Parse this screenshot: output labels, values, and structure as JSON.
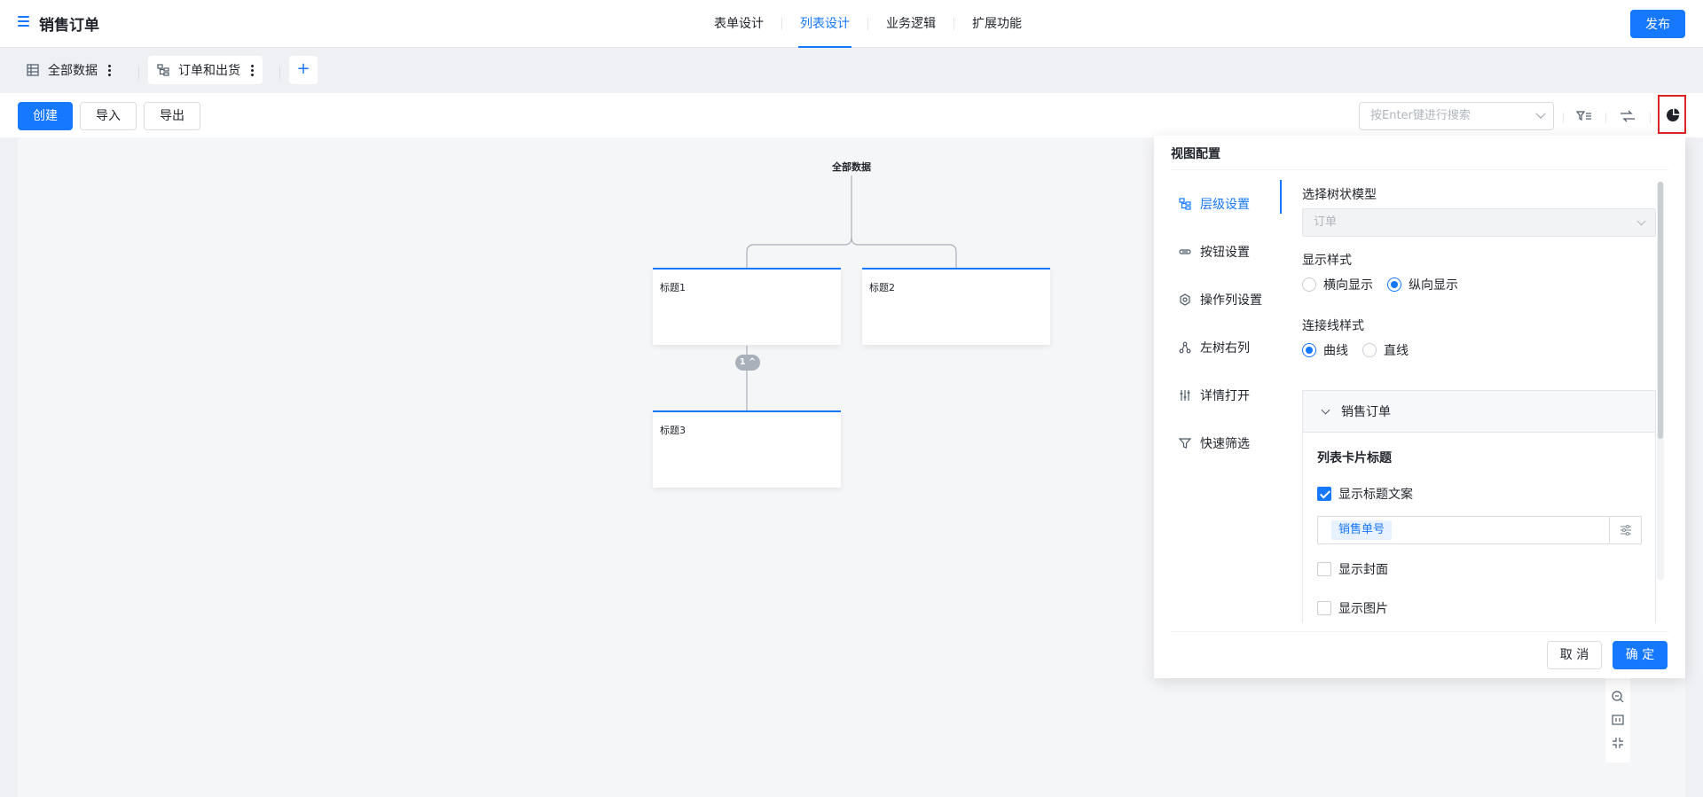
{
  "header": {
    "title": "销售订单",
    "tabs": [
      "表单设计",
      "列表设计",
      "业务逻辑",
      "扩展功能"
    ],
    "active_tab": "列表设计",
    "publish_label": "发布"
  },
  "views": {
    "items": [
      {
        "label": "全部数据",
        "icon": "grid-icon"
      },
      {
        "label": "订单和出货",
        "icon": "tree-icon"
      }
    ],
    "add_label": "+"
  },
  "toolbar": {
    "create_label": "创建",
    "import_label": "导入",
    "export_label": "导出",
    "search_placeholder": "按Enter键进行搜索"
  },
  "tree": {
    "root_label": "全部数据",
    "nodes": [
      {
        "title": "标题1"
      },
      {
        "title": "标题2"
      },
      {
        "title": "标题3"
      }
    ],
    "collapse_badge": "1 ^"
  },
  "config_panel": {
    "title": "视图配置",
    "nav": [
      {
        "label": "层级设置",
        "icon": "hierarchy-icon"
      },
      {
        "label": "按钮设置",
        "icon": "link-icon"
      },
      {
        "label": "操作列设置",
        "icon": "settings-icon"
      },
      {
        "label": "左树右列",
        "icon": "tree-nodes-icon"
      },
      {
        "label": "详情打开",
        "icon": "sliders-icon"
      },
      {
        "label": "快速筛选",
        "icon": "filter-icon"
      }
    ],
    "active_nav": "层级设置",
    "tree_model": {
      "label": "选择树状模型",
      "value": "订单"
    },
    "display_style": {
      "label": "显示样式",
      "options": [
        "横向显示",
        "纵向显示"
      ],
      "selected": "纵向显示"
    },
    "line_style": {
      "label": "连接线样式",
      "options": [
        "曲线",
        "直线"
      ],
      "selected": "曲线"
    },
    "section": {
      "title": "销售订单",
      "card_title_label": "列表卡片标题",
      "show_title_label": "显示标题文案",
      "show_title_checked": true,
      "title_field_tag": "销售单号",
      "show_cover_label": "显示封面",
      "show_cover_checked": false,
      "show_image_label": "显示图片",
      "show_image_checked": false
    },
    "cancel_label": "取 消",
    "ok_label": "确 定"
  },
  "colors": {
    "primary": "#1677ff",
    "highlight_border": "#e02424"
  }
}
